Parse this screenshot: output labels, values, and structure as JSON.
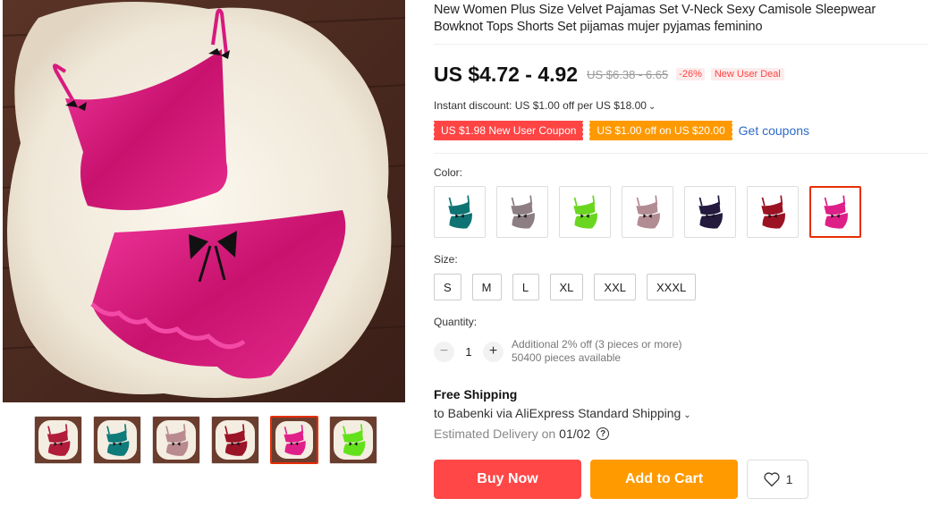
{
  "product": {
    "title": "New Women Plus Size Velvet Pajamas Set V-Neck Sexy Camisole Sleepwear Bowknot Tops Shorts Set pijamas mujer pyjamas feminino",
    "price": "US $4.72 - 4.92",
    "old_price": "US $6.38 - 6.65",
    "discount": "-26%",
    "new_user_deal": "New User Deal",
    "main_image_color": "#e0208a"
  },
  "promo": {
    "instant_discount": "Instant discount: US $1.00 off per US $18.00",
    "coupons": [
      "US $1.98 New User Coupon",
      "US $1.00 off on US $20.00"
    ],
    "get_coupons": "Get coupons"
  },
  "gallery": {
    "thumbnails": [
      {
        "color": "#b01c3a",
        "icon": "multicolor-pajama-thumb"
      },
      {
        "color": "#0f7b7b",
        "icon": "teal-pajama-thumb"
      },
      {
        "color": "#b98a8f",
        "icon": "pink-pajama-thumb"
      },
      {
        "color": "#9a1326",
        "icon": "wine-pajama-thumb"
      },
      {
        "color": "#e0208a",
        "icon": "rose-pajama-thumb"
      },
      {
        "color": "#63e21c",
        "icon": "green-pajama-thumb"
      }
    ],
    "active_index": 4
  },
  "color": {
    "label": "Color:",
    "options": [
      {
        "color": "#0f7373",
        "name": "teal"
      },
      {
        "color": "#8c7e82",
        "name": "gray"
      },
      {
        "color": "#6bd620",
        "name": "green"
      },
      {
        "color": "#b28c93",
        "name": "pink"
      },
      {
        "color": "#231a3e",
        "name": "navy"
      },
      {
        "color": "#9b1223",
        "name": "wine-red"
      },
      {
        "color": "#de1f88",
        "name": "rose"
      }
    ],
    "selected_index": 6
  },
  "size": {
    "label": "Size:",
    "options": [
      "S",
      "M",
      "L",
      "XL",
      "XXL",
      "XXXL"
    ]
  },
  "quantity": {
    "label": "Quantity:",
    "value": "1",
    "minus": "−",
    "plus": "+",
    "note1": "Additional 2% off (3 pieces or more)",
    "note2": "50400 pieces available"
  },
  "shipping": {
    "title": "Free Shipping",
    "to": "to Babenki via AliExpress Standard Shipping",
    "est_label": "Estimated Delivery on",
    "est_date": "01/02"
  },
  "actions": {
    "buy_now": "Buy Now",
    "add_to_cart": "Add to Cart",
    "wishlist_count": "1"
  }
}
